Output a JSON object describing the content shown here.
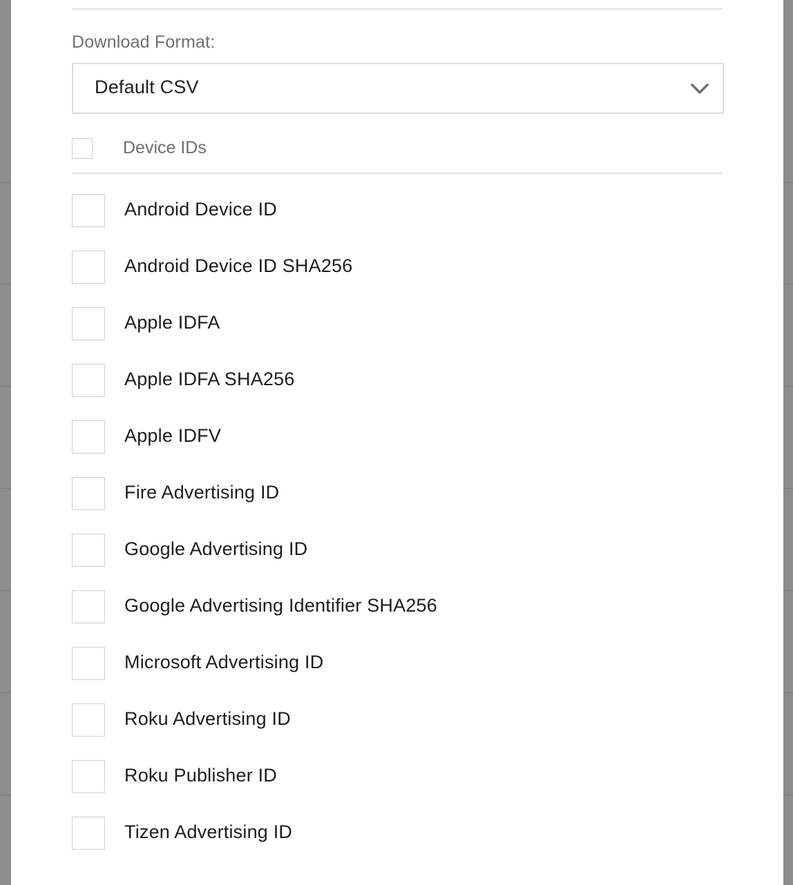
{
  "download_format": {
    "label": "Download Format:",
    "selected": "Default CSV",
    "chevron_icon": "chevron-down-icon"
  },
  "device_ids": {
    "group_label": "Device IDs",
    "items": [
      {
        "label": "Android Device ID",
        "checked": false
      },
      {
        "label": "Android Device ID SHA256",
        "checked": false
      },
      {
        "label": "Apple IDFA",
        "checked": false
      },
      {
        "label": "Apple IDFA SHA256",
        "checked": false
      },
      {
        "label": "Apple IDFV",
        "checked": false
      },
      {
        "label": "Fire Advertising ID",
        "checked": false
      },
      {
        "label": "Google Advertising ID",
        "checked": false
      },
      {
        "label": "Google Advertising Identifier SHA256",
        "checked": false
      },
      {
        "label": "Microsoft Advertising ID",
        "checked": false
      },
      {
        "label": "Roku Advertising ID",
        "checked": false
      },
      {
        "label": "Roku Publisher ID",
        "checked": false
      },
      {
        "label": "Tizen Advertising ID",
        "checked": false
      }
    ]
  }
}
